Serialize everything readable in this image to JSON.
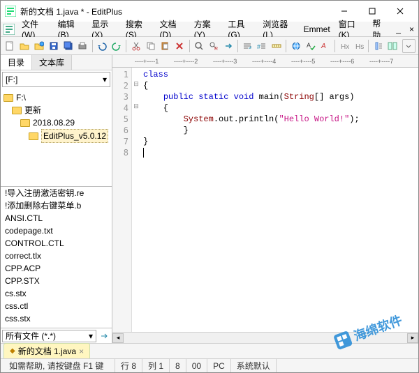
{
  "title": "新的文档 1.java * - EditPlus",
  "menus": [
    "文件(W)",
    "编辑(B)",
    "显示(X)",
    "搜索(S)",
    "文档(D)",
    "方案(Y)",
    "工具(G)",
    "浏览器(L)",
    "Emmet",
    "窗口(K)",
    "帮助"
  ],
  "sidebar": {
    "tabs": [
      "目录",
      "文本库"
    ],
    "drive_label": "[F:]",
    "tree": [
      {
        "label": "F:\\",
        "level": 0
      },
      {
        "label": "更新",
        "level": 1
      },
      {
        "label": "2018.08.29",
        "level": 2
      },
      {
        "label": "EditPlus_v5.0.12",
        "level": 3,
        "selected": true
      }
    ],
    "files": [
      "!导入注册激活密钥.re",
      "!添加删除右键菜单.b",
      "ANSI.CTL",
      "codepage.txt",
      "CONTROL.CTL",
      "correct.tlx",
      "CPP.ACP",
      "CPP.STX",
      "cs.stx",
      "css.ctl",
      "css.stx"
    ],
    "filter": "所有文件 (*.*)"
  },
  "ruler": [
    "----+----1",
    "----+----2",
    "----+----3",
    "----+----4",
    "----+----5",
    "----+----6",
    "----+----7"
  ],
  "code": {
    "lines": [
      1,
      2,
      3,
      4,
      5,
      6,
      7,
      8
    ],
    "l1": "class",
    "l2": "{",
    "l3a": "    ",
    "l3b": "public static void",
    "l3c": " main(",
    "l3d": "String",
    "l3e": "[] args)",
    "l4": "    {",
    "l5a": "        ",
    "l5b": "System",
    "l5c": ".out.println(",
    "l5d": "\"Hello World!\"",
    "l5e": ");",
    "l6": "        }",
    "l7": "}",
    "l8": ""
  },
  "doctab": "新的文档 1.java",
  "status": {
    "help": "如需帮助, 请按键盘 F1 键",
    "line_label": "行 8",
    "col_label": "列 1",
    "num1": "8",
    "num2": "00",
    "mode": "PC",
    "encoding": "系统默认"
  },
  "watermark": "海绵软件"
}
